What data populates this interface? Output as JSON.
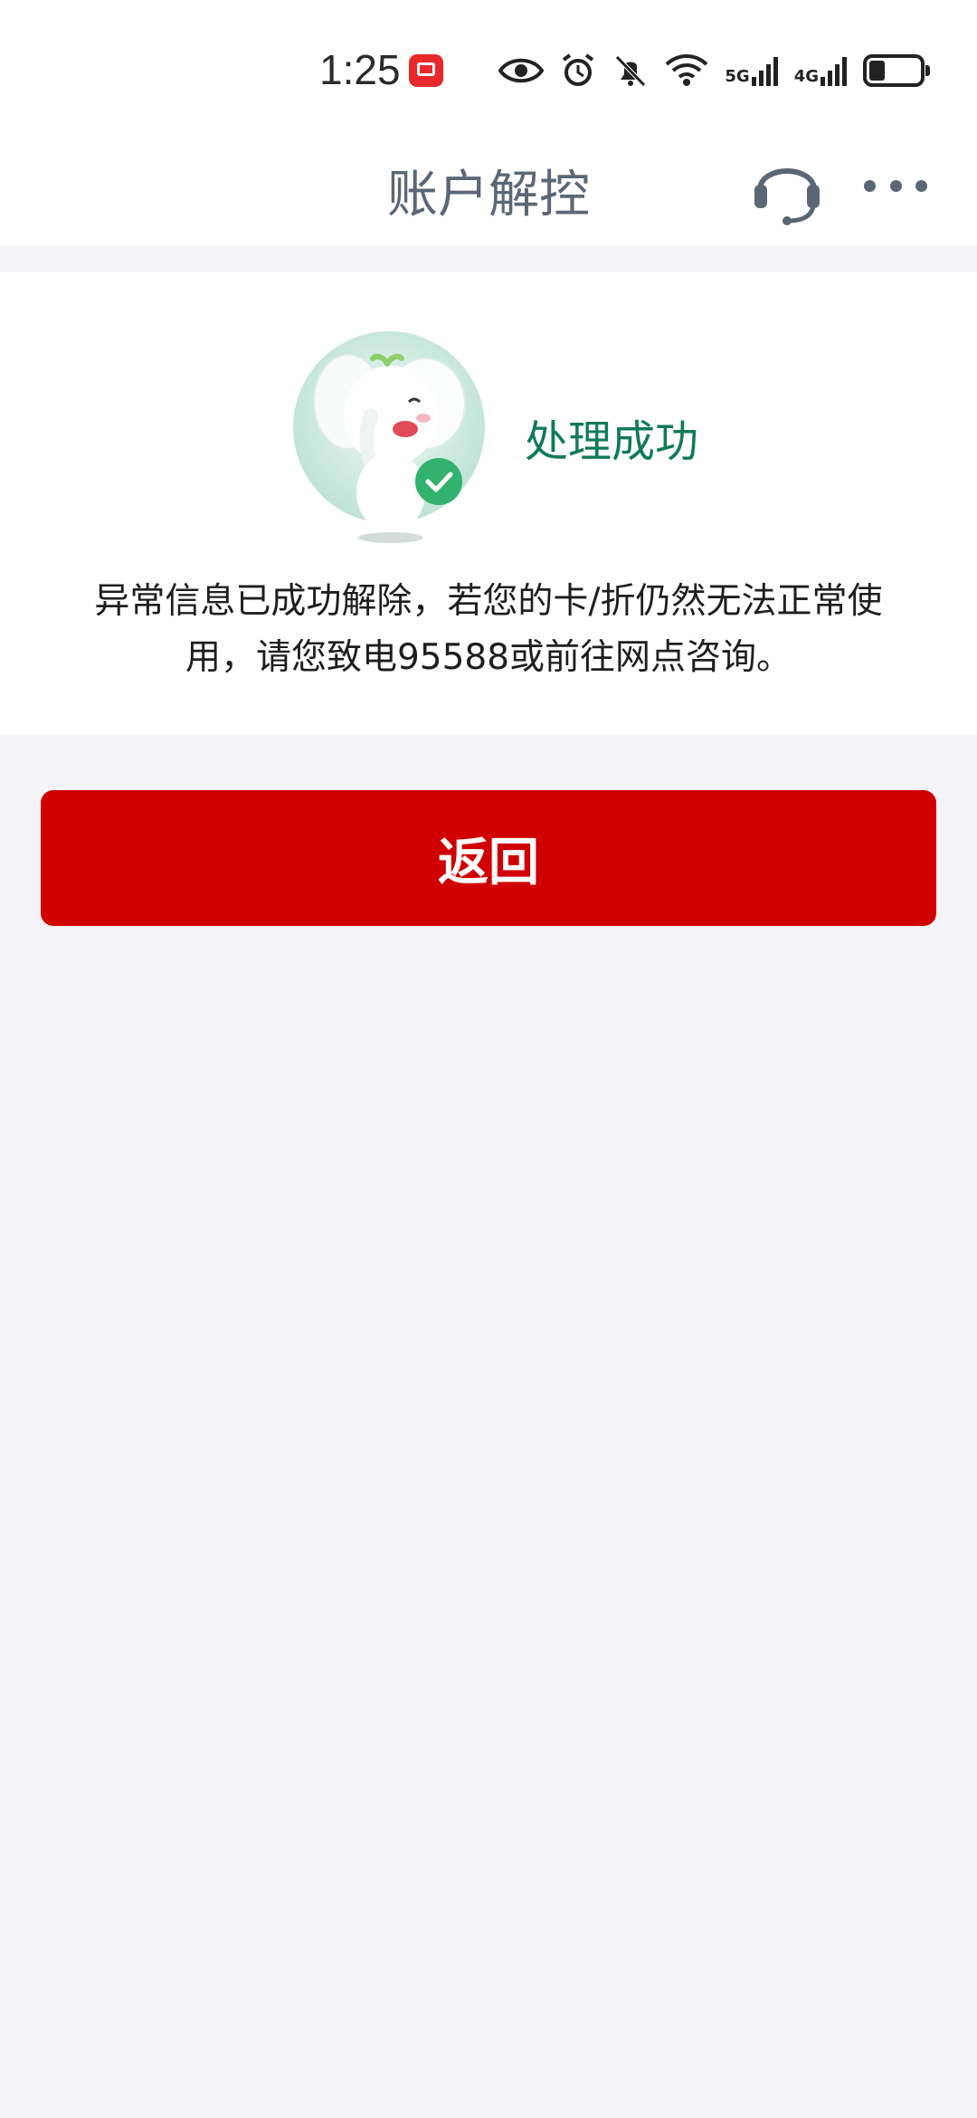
{
  "status_bar": {
    "time": "1:25",
    "net1": "5G",
    "net2": "4G",
    "icons": [
      "notification-badge-icon",
      "eye-icon",
      "alarm-icon",
      "mute-bell-icon",
      "wifi-icon",
      "signal-5g-icon",
      "signal-4g-icon",
      "battery-icon"
    ]
  },
  "header": {
    "title": "账户解控",
    "icons": [
      "headset-icon",
      "more-icon"
    ]
  },
  "result": {
    "status": "处理成功",
    "message": "异常信息已成功解除，若您的卡/折仍然无法正常使用，请您致电95588或前往网点咨询。",
    "image": "elephant-mascot-success-icon"
  },
  "actions": {
    "back_label": "返回"
  },
  "colors": {
    "accent_red": "#d10000",
    "success_green": "#0f7a5a",
    "title_gray": "#5b6776",
    "page_bg": "#f3f3f8"
  }
}
